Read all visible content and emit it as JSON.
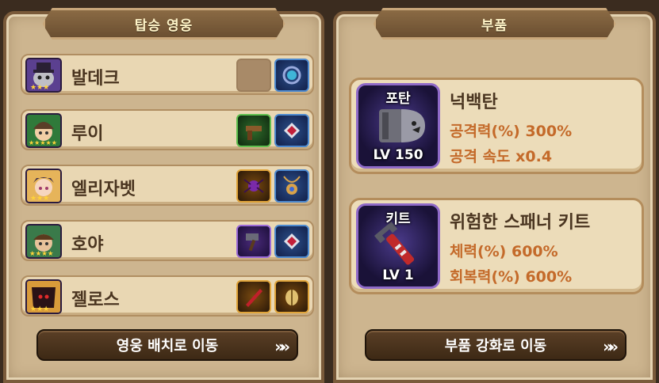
{
  "left_panel": {
    "title": "탑승 영웅",
    "heroes": [
      {
        "name": "발데크",
        "stars": 3
      },
      {
        "name": "루이",
        "stars": 5
      },
      {
        "name": "엘리자벳",
        "stars": 3
      },
      {
        "name": "호야",
        "stars": 4
      },
      {
        "name": "젤로스",
        "stars": 3
      }
    ],
    "button_label": "영웅 배치로 이동",
    "button_arrow": "»»"
  },
  "right_panel": {
    "title": "부품",
    "parts": [
      {
        "type": "포탄",
        "level": "LV 150",
        "name": "넉백탄",
        "stat1": "공격력(%) 300%",
        "stat2": "공격 속도 x0.4"
      },
      {
        "type": "키트",
        "level": "LV 1",
        "name": "위험한 스패너 키트",
        "stat1": "체력(%) 600%",
        "stat2": "회복력(%) 600%"
      }
    ],
    "button_label": "부품 강화로 이동",
    "button_arrow": "»»"
  },
  "colors": {
    "panel_bg": "#cdb58f",
    "stat_text": "#c46a2a",
    "name_text": "#4a3520"
  }
}
